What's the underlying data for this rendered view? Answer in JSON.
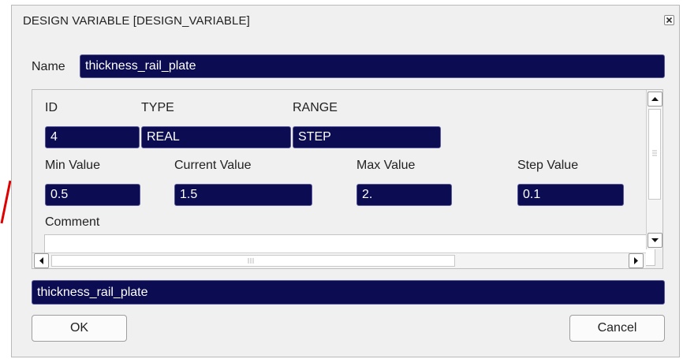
{
  "dialog": {
    "title": "DESIGN VARIABLE [DESIGN_VARIABLE]",
    "close_icon": "close-x-icon"
  },
  "name_row": {
    "label": "Name",
    "value": "thickness_rail_plate"
  },
  "panel": {
    "id_label": "ID",
    "type_label": "TYPE",
    "range_label": "RANGE",
    "id_value": "4",
    "type_value": "REAL",
    "range_value": "STEP",
    "min_label": "Min Value",
    "current_label": "Current Value",
    "max_label": "Max Value",
    "step_label": "Step Value",
    "min_value": "0.5",
    "current_value": "1.5",
    "max_value": "2.",
    "step_value": "0.1",
    "comment_label": "Comment",
    "comment_value": ""
  },
  "expression": {
    "value": "thickness_rail_plate"
  },
  "buttons": {
    "ok": "OK",
    "cancel": "Cancel"
  },
  "colors": {
    "field_bg": "#0b0c52",
    "dialog_bg": "#f0f0f0",
    "arrow": "#e00000"
  }
}
